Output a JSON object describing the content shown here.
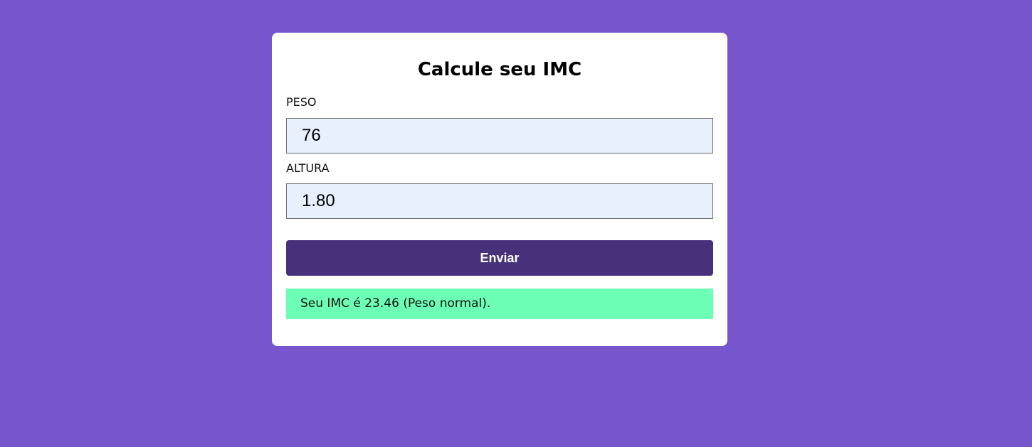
{
  "form": {
    "title": "Calcule seu IMC",
    "peso": {
      "label": "PESO",
      "value": "76"
    },
    "altura": {
      "label": "ALTURA",
      "value": "1.80"
    },
    "submit_label": "Enviar",
    "result_text": "Seu IMC é 23.46 (Peso normal)."
  },
  "colors": {
    "background": "#7755CC",
    "card": "#FFFFFF",
    "input_background": "#E8F0FE",
    "button": "#47317A",
    "result_background": "#6DFEB6"
  }
}
